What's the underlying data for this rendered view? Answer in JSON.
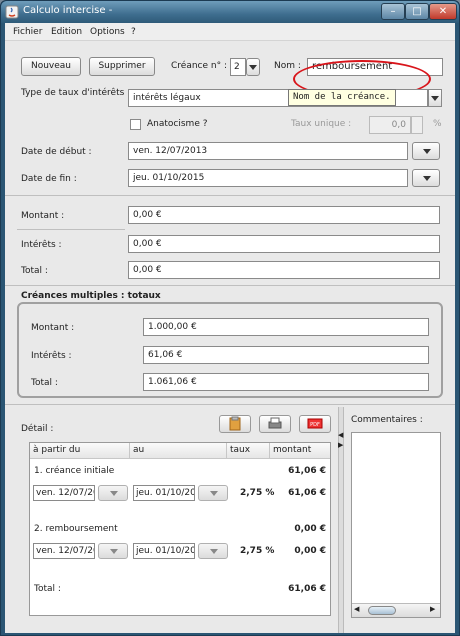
{
  "window": {
    "title": "Calculo intercise -",
    "min_label": "–",
    "max_label": "□",
    "close_label": "✕"
  },
  "menu": [
    "Fichier",
    "Edition",
    "Options",
    "?"
  ],
  "toolbar": {
    "new_label": "Nouveau",
    "delete_label": "Supprimer",
    "creance_label": "Créance n° :",
    "creance_value": "2",
    "nom_label": "Nom :",
    "nom_value": "remboursement"
  },
  "tooltip": "Nom de la créance.",
  "rate": {
    "type_label": "Type de taux d'intérêts :",
    "type_value": "intérêts légaux",
    "anatocisme_label": "Anatocisme ?",
    "unique_label": "Taux unique :",
    "unique_value": "0,0",
    "percent": "%"
  },
  "dates": {
    "debut_label": "Date de début :",
    "debut_value": "ven. 12/07/2013",
    "fin_label": "Date de fin :",
    "fin_value": "jeu. 01/10/2015"
  },
  "amounts": {
    "montant_label": "Montant :",
    "montant_value": "0,00 €",
    "interets_label": "Intérêts :",
    "interets_value": "0,00 €",
    "total_label": "Total :",
    "total_value": "0,00 €"
  },
  "multiples": {
    "title": "Créances multiples : totaux",
    "montant_label": "Montant :",
    "montant_value": "1.000,00 €",
    "interets_label": "Intérêts :",
    "interets_value": "61,06 €",
    "total_label": "Total :",
    "total_value": "1.061,06 €"
  },
  "detail": {
    "label": "Détail :",
    "headers": [
      "à partir du",
      "au",
      "taux",
      "montant"
    ],
    "rows": [
      {
        "name": "1. créance initiale",
        "amount": "61,06 €",
        "from": "ven. 12/07/20",
        "to": "jeu. 01/10/20",
        "rate": "2,75 %",
        "value": "61,06 €"
      },
      {
        "name": "2. remboursement",
        "amount": "0,00 €",
        "from": "ven. 12/07/20",
        "to": "jeu. 01/10/20",
        "rate": "2,75 %",
        "value": "0,00 €"
      }
    ],
    "total_label": "Total :",
    "total_value": "61,06 €"
  },
  "comments": {
    "label": "Commentaires :"
  },
  "icons": {
    "export_pdf": "PDF"
  }
}
